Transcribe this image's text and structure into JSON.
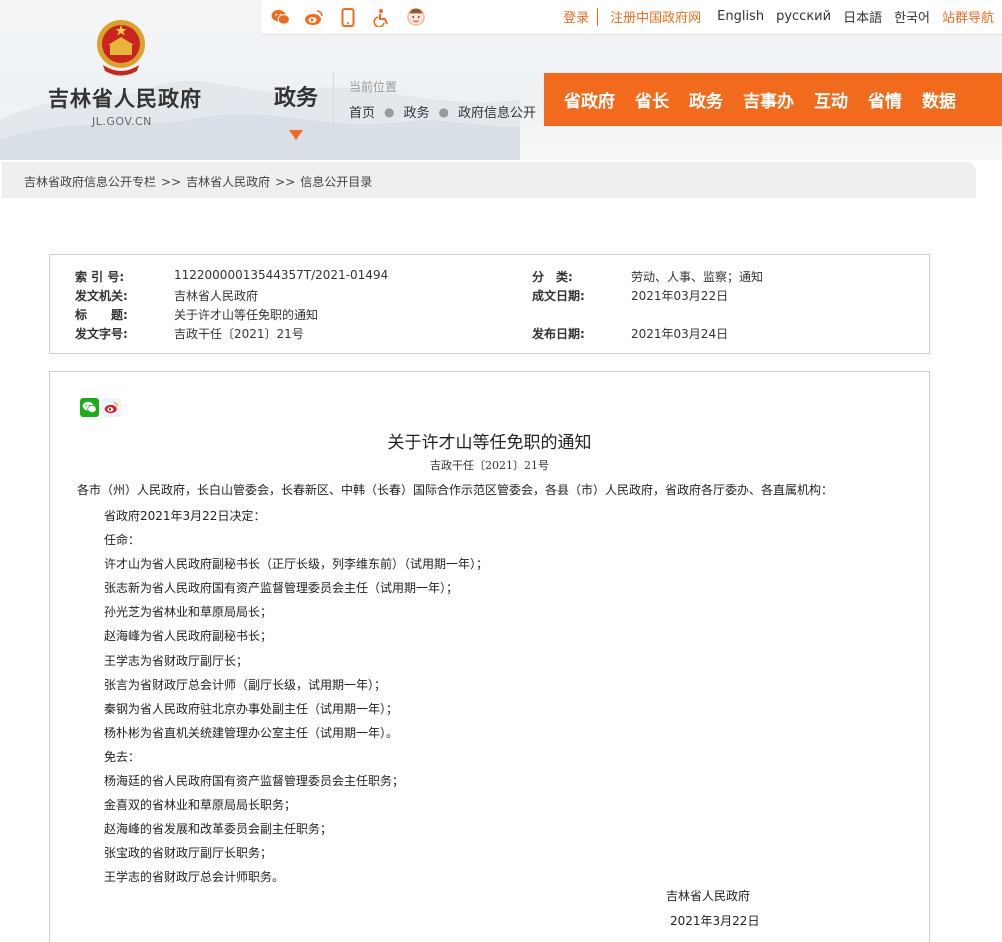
{
  "header": {
    "site_name": "吉林省人民政府",
    "site_domain": "JL.GOV.CN",
    "channel": "政务",
    "location_label": "当前位置",
    "location": [
      "首页",
      "政务",
      "政府信息公开"
    ],
    "top_icons": [
      "wechat-icon",
      "weibo-icon",
      "mobile-icon",
      "accessibility-icon",
      "mascot-icon"
    ],
    "top_links": {
      "login": "登录",
      "register": "注册中国政府网",
      "english": "English",
      "russian": "русский",
      "japanese": "日本語",
      "korean": "한국어",
      "sitemap": "站群导航"
    },
    "nav": [
      "省政府",
      "省长",
      "政务",
      "吉事办",
      "互动",
      "省情",
      "数据"
    ],
    "accent_color": "#f26b1d"
  },
  "breadcrumb": [
    "吉林省政府信息公开专栏",
    "吉林省人民政府",
    "信息公开目录"
  ],
  "breadcrumb_sep": ">>",
  "meta": {
    "index_label": "索 引 号:",
    "index_value": "11220000013544357T/2021-01494",
    "category_label": "分　类:",
    "category_value": "劳动、人事、监察；通知",
    "issuer_label": "发文机关:",
    "issuer_value": "吉林省人民政府",
    "date_made_label": "成文日期:",
    "date_made_value": "2021年03月22日",
    "title_label": "标　　题:",
    "title_value": "关于许才山等任免职的通知",
    "doc_no_label": "发文字号:",
    "doc_no_value": "吉政干任〔2021〕21号",
    "publish_label": "发布日期:",
    "publish_value": "2021年03月24日"
  },
  "document": {
    "title": "关于许才山等任免职的通知",
    "number": "吉政干任〔2021〕21号",
    "addressee": "各市（州）人民政府，长白山管委会，长春新区、中韩（长春）国际合作示范区管委会，各县（市）人民政府，省政府各厅委办、各直属机构：",
    "lines": [
      "省政府2021年3月22日决定：",
      "任命：",
      "许才山为省人民政府副秘书长（正厅长级，列李维东前）（试用期一年）；",
      "张志新为省人民政府国有资产监督管理委员会主任（试用期一年）；",
      "孙光芝为省林业和草原局局长；",
      "赵海峰为省人民政府副秘书长；",
      "王学志为省财政厅副厅长；",
      "张言为省财政厅总会计师（副厅长级，试用期一年）；",
      "秦钢为省人民政府驻北京办事处副主任（试用期一年）；",
      "杨朴彬为省直机关统建管理办公室主任（试用期一年）。",
      "免去：",
      "杨海廷的省人民政府国有资产监督管理委员会主任职务；",
      "金喜双的省林业和草原局局长职务；",
      "赵海峰的省发展和改革委员会副主任职务；",
      "张宝政的省财政厅副厅长职务；",
      "王学志的省财政厅总会计师职务。"
    ],
    "signer": "吉林省人民政府",
    "sign_date": "2021年3月22日"
  }
}
